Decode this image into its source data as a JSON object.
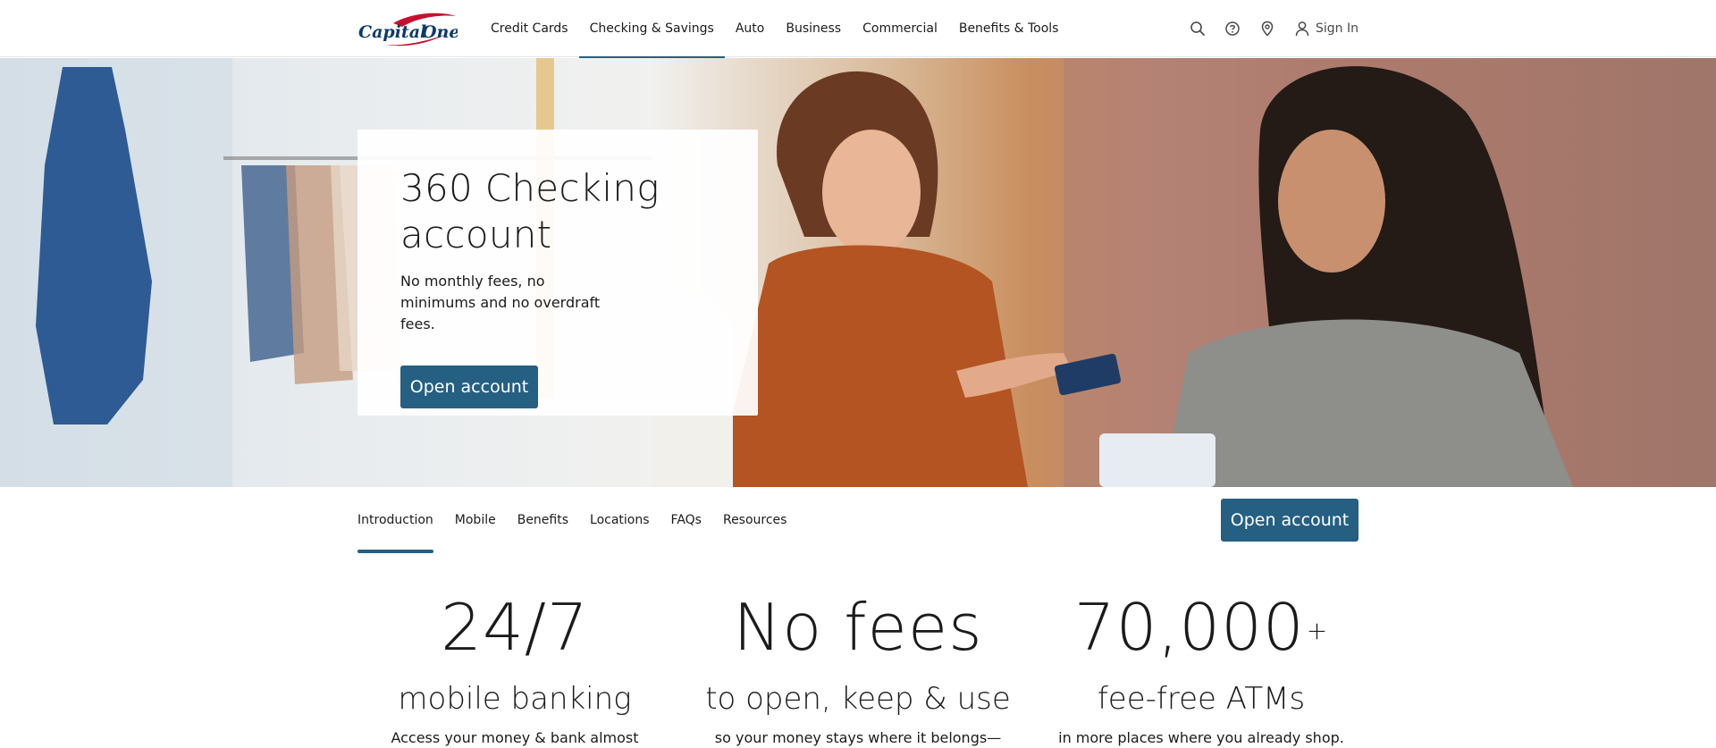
{
  "brand": {
    "logo_text": "Capital One",
    "accent": "#255f82",
    "logo_swoosh": "#c8102e"
  },
  "header": {
    "nav": [
      {
        "label": "Credit Cards",
        "active": false
      },
      {
        "label": "Checking & Savings",
        "active": true
      },
      {
        "label": "Auto",
        "active": false
      },
      {
        "label": "Business",
        "active": false
      },
      {
        "label": "Commercial",
        "active": false
      },
      {
        "label": "Benefits & Tools",
        "active": false
      }
    ],
    "icons": [
      "search-icon",
      "help-icon",
      "location-pin-icon",
      "user-icon"
    ],
    "sign_in": "Sign In"
  },
  "hero": {
    "title": "360 Checking account",
    "subtitle": "No monthly fees, no minimums and no overdraft fees.",
    "cta": "Open account"
  },
  "subnav": {
    "items": [
      "Introduction",
      "Mobile",
      "Benefits",
      "Locations",
      "FAQs",
      "Resources"
    ],
    "active": "Introduction",
    "cta": "Open account"
  },
  "features": [
    {
      "stat": "24/7",
      "sup": "",
      "heading": "mobile banking",
      "desc": "Access your money & bank almost anywhere"
    },
    {
      "stat": "No fees",
      "sup": "",
      "heading": "to open, keep & use",
      "desc": "so your money stays where it belongs—with"
    },
    {
      "stat": "70,000",
      "sup": "+",
      "heading": "fee-free ATMs",
      "desc": "in more places where you already shop."
    }
  ]
}
